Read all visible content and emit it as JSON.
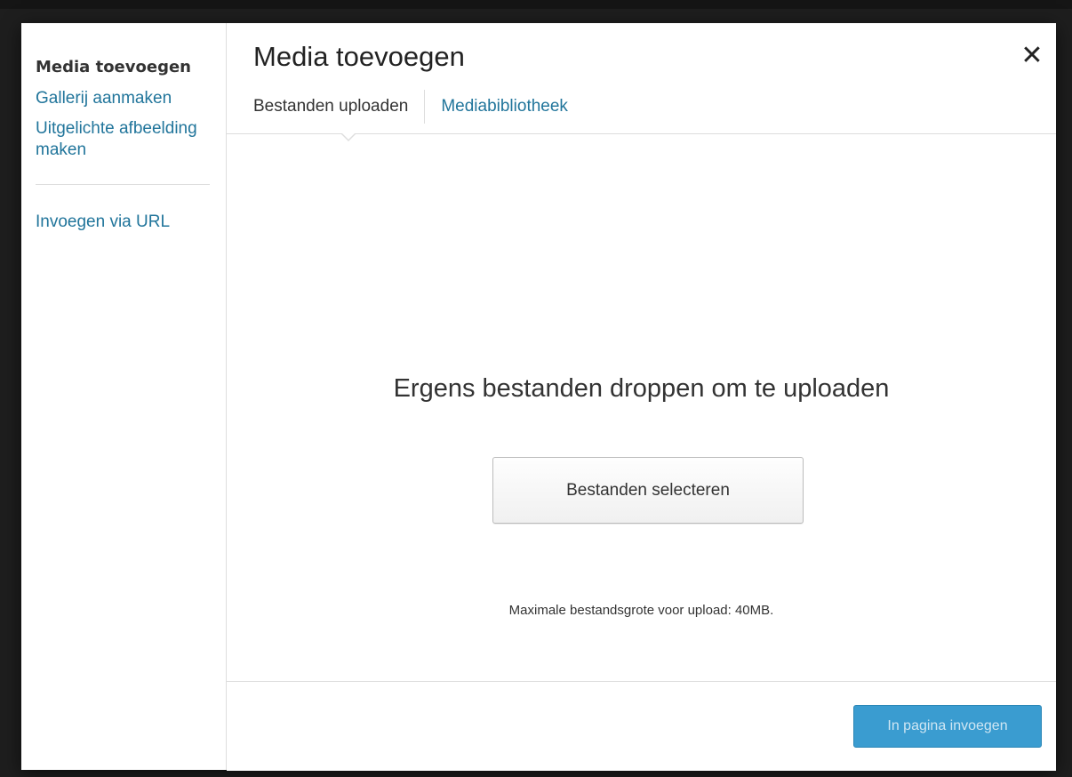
{
  "sidebar": {
    "active_label": "Media toevoegen",
    "items": [
      {
        "label": "Gallerij aanmaken"
      },
      {
        "label": "Uitgelichte afbeelding maken"
      }
    ],
    "url_item": {
      "label": "Invoegen via URL"
    }
  },
  "header": {
    "title": "Media toevoegen",
    "close_icon": "close-icon"
  },
  "tabs": [
    {
      "label": "Bestanden uploaden",
      "active": true
    },
    {
      "label": "Mediabibliotheek",
      "active": false
    }
  ],
  "uploader": {
    "drop_text": "Ergens bestanden droppen om te uploaden",
    "select_button": "Bestanden selecteren",
    "max_size_text": "Maximale bestandsgrote voor upload: 40MB."
  },
  "toolbar": {
    "insert_button": "In pagina invoegen",
    "insert_enabled": false
  },
  "colors": {
    "link": "#21759b",
    "primary_button": "#3a9cd0"
  }
}
